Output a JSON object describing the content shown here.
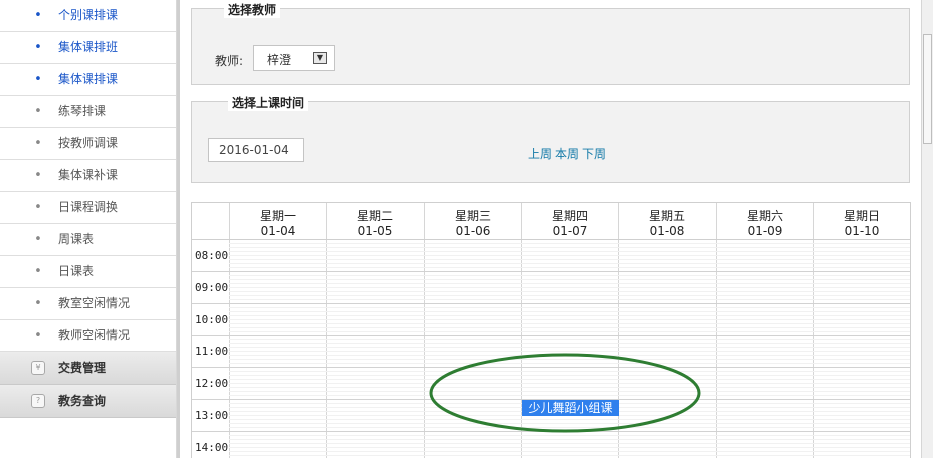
{
  "sidebar": {
    "items": [
      {
        "label": "个别课排课",
        "style": "blue"
      },
      {
        "label": "集体课排班",
        "style": "blue"
      },
      {
        "label": "集体课排课",
        "style": "blue"
      },
      {
        "label": "练琴排课",
        "style": "gray"
      },
      {
        "label": "按教师调课",
        "style": "gray"
      },
      {
        "label": "集体课补课",
        "style": "gray"
      },
      {
        "label": "日课程调换",
        "style": "gray"
      },
      {
        "label": "周课表",
        "style": "gray"
      },
      {
        "label": "日课表",
        "style": "gray"
      },
      {
        "label": "教室空闲情况",
        "style": "gray"
      },
      {
        "label": "教师空闲情况",
        "style": "gray"
      }
    ],
    "bullet": "•",
    "groups": [
      {
        "label": "交费管理",
        "icon": "payment-icon"
      },
      {
        "label": "教务查询",
        "icon": "query-icon"
      }
    ]
  },
  "teacher_panel": {
    "legend": "选择教师",
    "label": "教师:",
    "selected": "梓澄",
    "arrow": "▼"
  },
  "time_panel": {
    "legend": "选择上课时间",
    "date_value": "2016-01-04",
    "prev_week": "上周",
    "this_week": "本周",
    "next_week": "下周"
  },
  "calendar": {
    "days": [
      {
        "name": "星期一",
        "date": "01-04"
      },
      {
        "name": "星期二",
        "date": "01-05"
      },
      {
        "name": "星期三",
        "date": "01-06"
      },
      {
        "name": "星期四",
        "date": "01-07"
      },
      {
        "name": "星期五",
        "date": "01-08"
      },
      {
        "name": "星期六",
        "date": "01-09"
      },
      {
        "name": "星期日",
        "date": "01-10"
      }
    ],
    "times": [
      "08:00",
      "09:00",
      "10:00",
      "11:00",
      "12:00",
      "13:00",
      "14:00"
    ],
    "event": {
      "label": "少儿舞蹈小组课",
      "day": "星期四",
      "time": "13:00"
    },
    "highlight_color": "#2e7d32",
    "event_color": "#2f80ed"
  }
}
